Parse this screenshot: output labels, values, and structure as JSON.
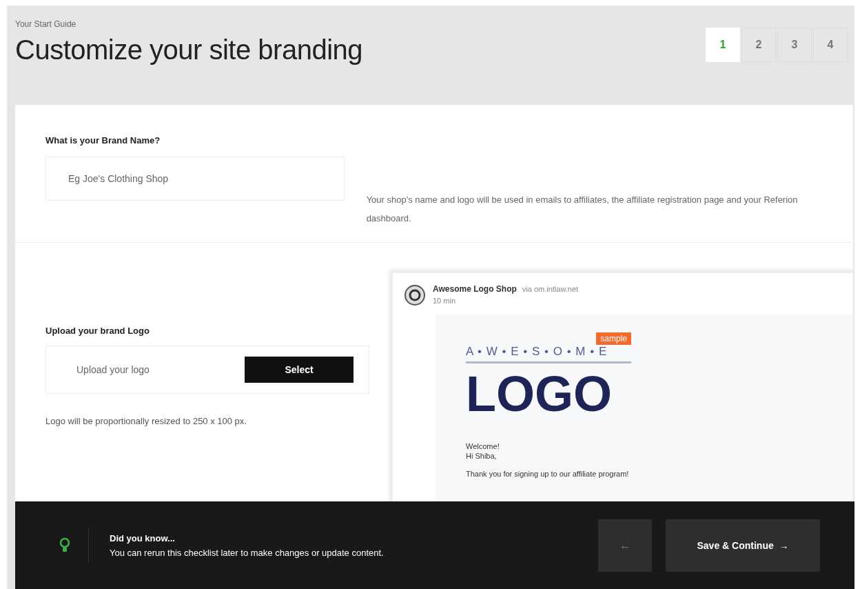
{
  "header": {
    "eyebrow": "Your Start Guide",
    "title": "Customize your site branding"
  },
  "steps": [
    {
      "label": "1",
      "selected": true
    },
    {
      "label": "2",
      "selected": false
    },
    {
      "label": "3",
      "selected": false
    },
    {
      "label": "4",
      "selected": false
    }
  ],
  "brand": {
    "label": "What is your Brand Name?",
    "placeholder": "Eg Joe's Clothing Shop",
    "description": "Your shop's name and logo will be used in emails to affiliates, the affiliate registration page and your Referion dashboard."
  },
  "logo": {
    "label": "Upload your brand Logo",
    "placeholder": "Upload your logo",
    "button": "Select",
    "note": "Logo will be proportionally resized to 250 x 100 px."
  },
  "email_preview": {
    "sender": "Awesome Logo Shop",
    "via": "via om.intlaw.net",
    "time": "10 min",
    "badge": "sample",
    "logo_top": "A • W • E • S • O • M • E",
    "logo_main": "LOGO",
    "greeting": "Welcome!",
    "salutation": "Hi Shiba,",
    "body": "Thank you for signing up to our affiliate program!"
  },
  "footer": {
    "tip_title": "Did you know...",
    "tip_text": "You can rerun this checklist later to make changes or update content.",
    "back_button": "←",
    "save_button": "Save & Continue",
    "save_arrow": "→"
  }
}
